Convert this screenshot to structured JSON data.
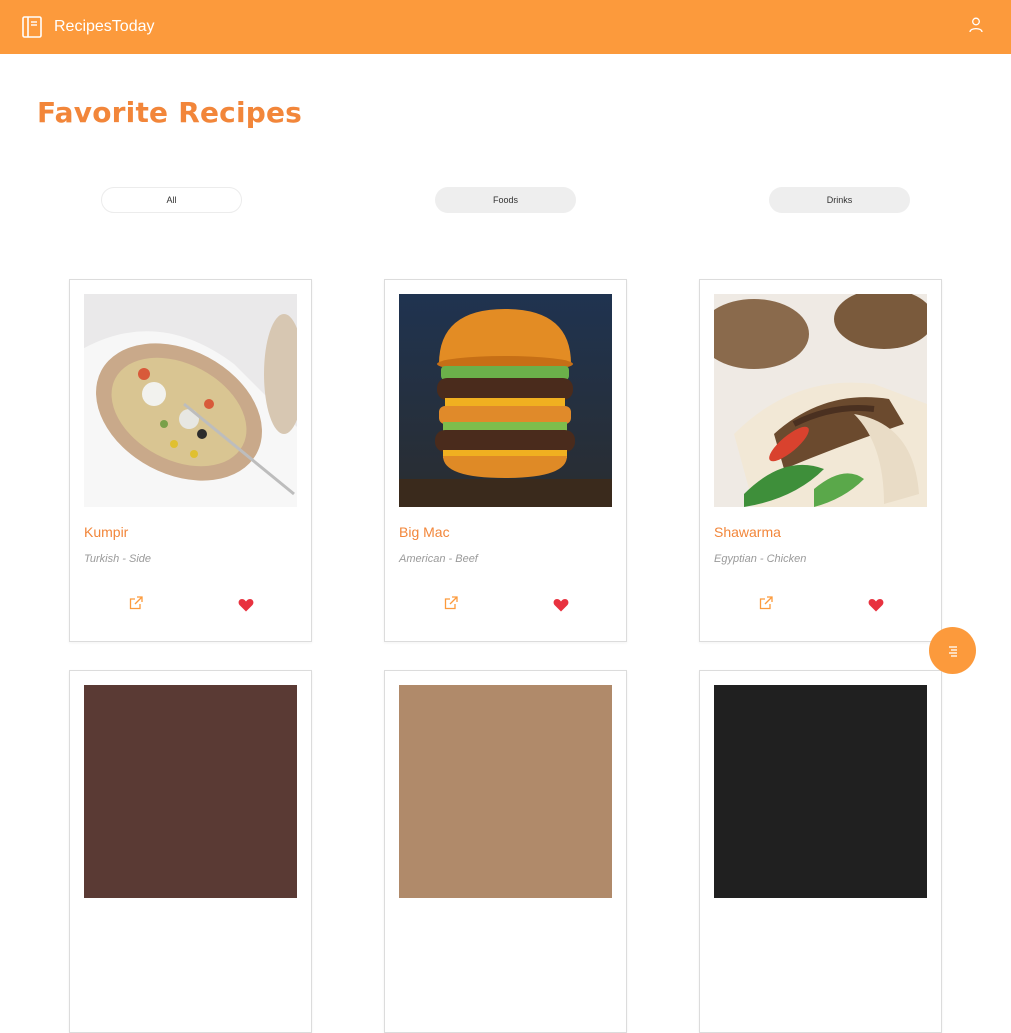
{
  "header": {
    "brand": "RecipesToday",
    "brand_icon": "book-icon",
    "profile_icon": "user-icon",
    "bg_color": "#fc9a3c"
  },
  "main": {
    "title": "Favorite Recipes",
    "filters": [
      "All",
      "Foods",
      "Drinks"
    ],
    "active_filter": "All",
    "accent_color": "#f2863a",
    "cards": [
      {
        "name": "Kumpir",
        "meta": "Turkish - Side",
        "favorited": true
      },
      {
        "name": "Big Mac",
        "meta": "American - Beef",
        "favorited": true
      },
      {
        "name": "Shawarma",
        "meta": "Egyptian - Chicken",
        "favorited": true
      }
    ],
    "card_icons": {
      "share": "share-link-icon",
      "favorite": "heart-icon"
    }
  },
  "fab": {
    "icon": "menu-icon"
  }
}
